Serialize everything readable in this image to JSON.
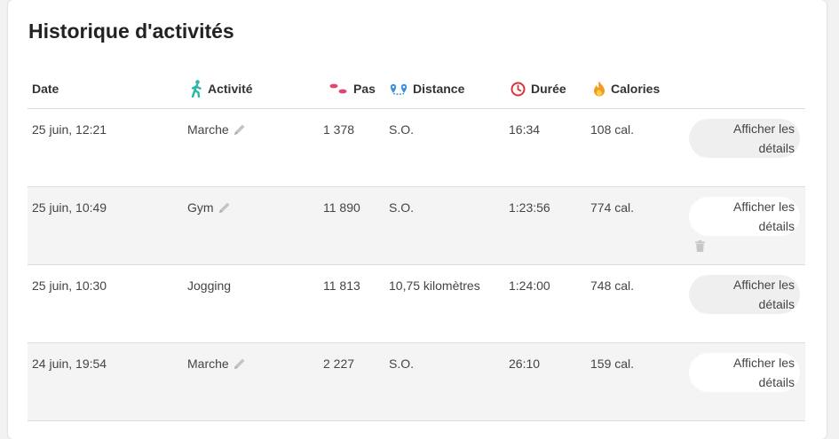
{
  "title": "Historique d'activités",
  "columns": {
    "date": "Date",
    "activity": "Activité",
    "steps": "Pas",
    "distance": "Distance",
    "duration": "Durée",
    "calories": "Calories"
  },
  "rows": [
    {
      "date": "25 juin, 12:21",
      "activity": "Marche",
      "editable": true,
      "steps": "1 378",
      "distance": "S.O.",
      "duration": "16:34",
      "calories": "108 cal.",
      "details_label": "Afficher les détails",
      "deletable": false
    },
    {
      "date": "25 juin, 10:49",
      "activity": "Gym",
      "editable": true,
      "steps": "11 890",
      "distance": "S.O.",
      "duration": "1:23:56",
      "calories": "774 cal.",
      "details_label": "Afficher les détails",
      "deletable": true
    },
    {
      "date": "25 juin, 10:30",
      "activity": "Jogging",
      "editable": false,
      "steps": "11 813",
      "distance": "10,75 kilomètres",
      "duration": "1:24:00",
      "calories": "748 cal.",
      "details_label": "Afficher les détails",
      "deletable": false
    },
    {
      "date": "24 juin, 19:54",
      "activity": "Marche",
      "editable": true,
      "steps": "2 227",
      "distance": "S.O.",
      "duration": "26:10",
      "calories": "159 cal.",
      "details_label": "Afficher les détails",
      "deletable": false
    }
  ],
  "icons": {
    "activity": "walking-person-icon",
    "steps": "footsteps-icon",
    "distance": "route-pins-icon",
    "duration": "clock-icon",
    "calories": "flame-icon",
    "edit": "pencil-icon",
    "delete": "trash-icon"
  },
  "colors": {
    "activity": "#2bb5a3",
    "steps": "#e0466f",
    "distance": "#3b8fd9",
    "duration": "#d9343c",
    "calories": "#f39a1f"
  }
}
